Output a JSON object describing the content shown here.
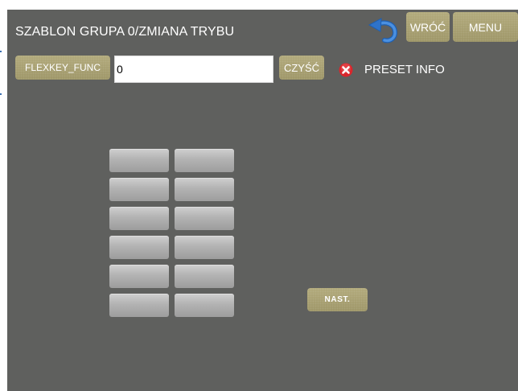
{
  "header": {
    "title": "SZABLON GRUPA 0/ZMIANA TRYBU",
    "back_label": "WRÓĆ",
    "menu_label": "MENU"
  },
  "func_row": {
    "func_button_label": "FLEXKEY_FUNC",
    "input_value": "0",
    "clear_label": "CZYŚĆ",
    "preset_info_label": "PRESET INFO"
  },
  "key_grid": {
    "rows": 6,
    "columns": 2,
    "labels": [
      "",
      "",
      "",
      "",
      "",
      "",
      "",
      "",
      "",
      "",
      "",
      ""
    ]
  },
  "next_label": "NAST.",
  "colors": {
    "panel_bg": "#5f605e",
    "khaki_button": "#a8a070",
    "gray_key": "#b3b3b3",
    "error_icon": "#d9262c",
    "undo_icon": "#2f73c9"
  },
  "icons": {
    "undo": "undo-arrow-icon",
    "preset_status": "error-x-icon"
  }
}
